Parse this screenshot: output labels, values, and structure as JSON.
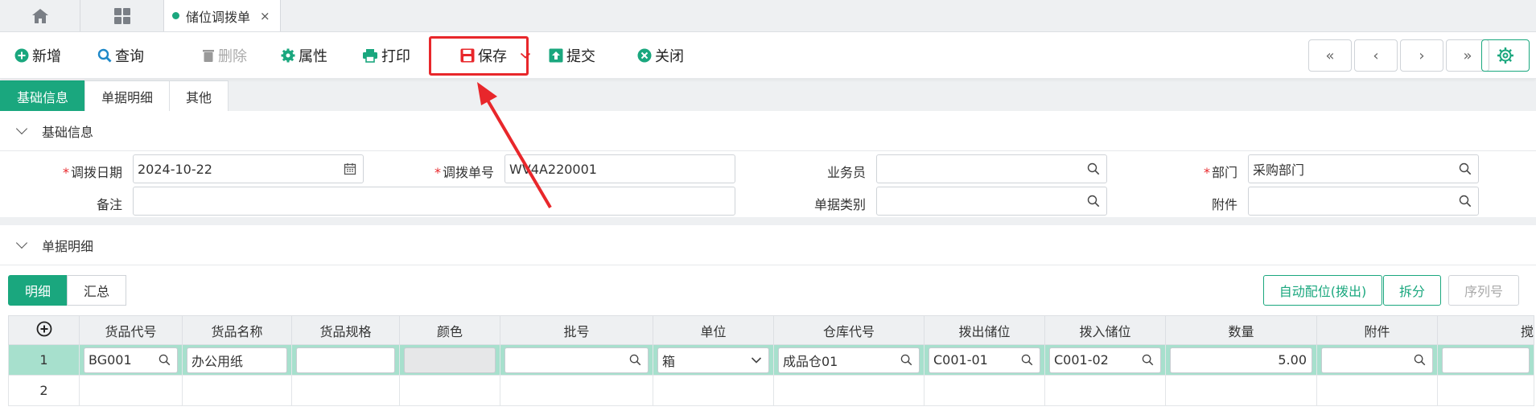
{
  "tabbar": {
    "active_tab": "储位调拨单",
    "close": "×"
  },
  "toolbar": {
    "add": "新增",
    "query": "查询",
    "delete": "删除",
    "props": "属性",
    "print": "打印",
    "save": "保存",
    "submit": "提交",
    "close": "关闭",
    "nav": [
      "«",
      "‹",
      "›",
      "»"
    ]
  },
  "subtabs": [
    "基础信息",
    "单据明细",
    "其他"
  ],
  "basic": {
    "section_title": "基础信息",
    "transfer_date_label": "调拨日期",
    "transfer_date": "2024-10-22",
    "transfer_no_label": "调拨单号",
    "transfer_no": "WV4A220001",
    "salesman_label": "业务员",
    "salesman": "",
    "dept_label": "部门",
    "dept": "采购部门",
    "remark_label": "备注",
    "remark": "",
    "doc_type_label": "单据类别",
    "doc_type": "",
    "attachment_label": "附件",
    "attachment": ""
  },
  "detail": {
    "section_title": "单据明细",
    "tabs": [
      "明细",
      "汇总"
    ],
    "auto_btn": "自动配位(拨出)",
    "split_btn": "拆分",
    "serial_btn": "序列号",
    "columns": [
      "货品代号",
      "货品名称",
      "货品规格",
      "颜色",
      "批号",
      "单位",
      "仓库代号",
      "拨出储位",
      "拨入储位",
      "数量",
      "附件",
      "搅"
    ],
    "rows": [
      {
        "no": "1",
        "code": "BG001",
        "name": "办公用纸",
        "spec": "",
        "color": "",
        "batch": "",
        "unit": "箱",
        "warehouse": "成品仓01",
        "out_loc": "C001-01",
        "in_loc": "C001-02",
        "qty": "5.00",
        "attach": ""
      },
      {
        "no": "2"
      }
    ]
  },
  "colors": {
    "accent": "#1aa77e",
    "highlight": "#e8272b",
    "row_selected": "#a7e0cd"
  }
}
